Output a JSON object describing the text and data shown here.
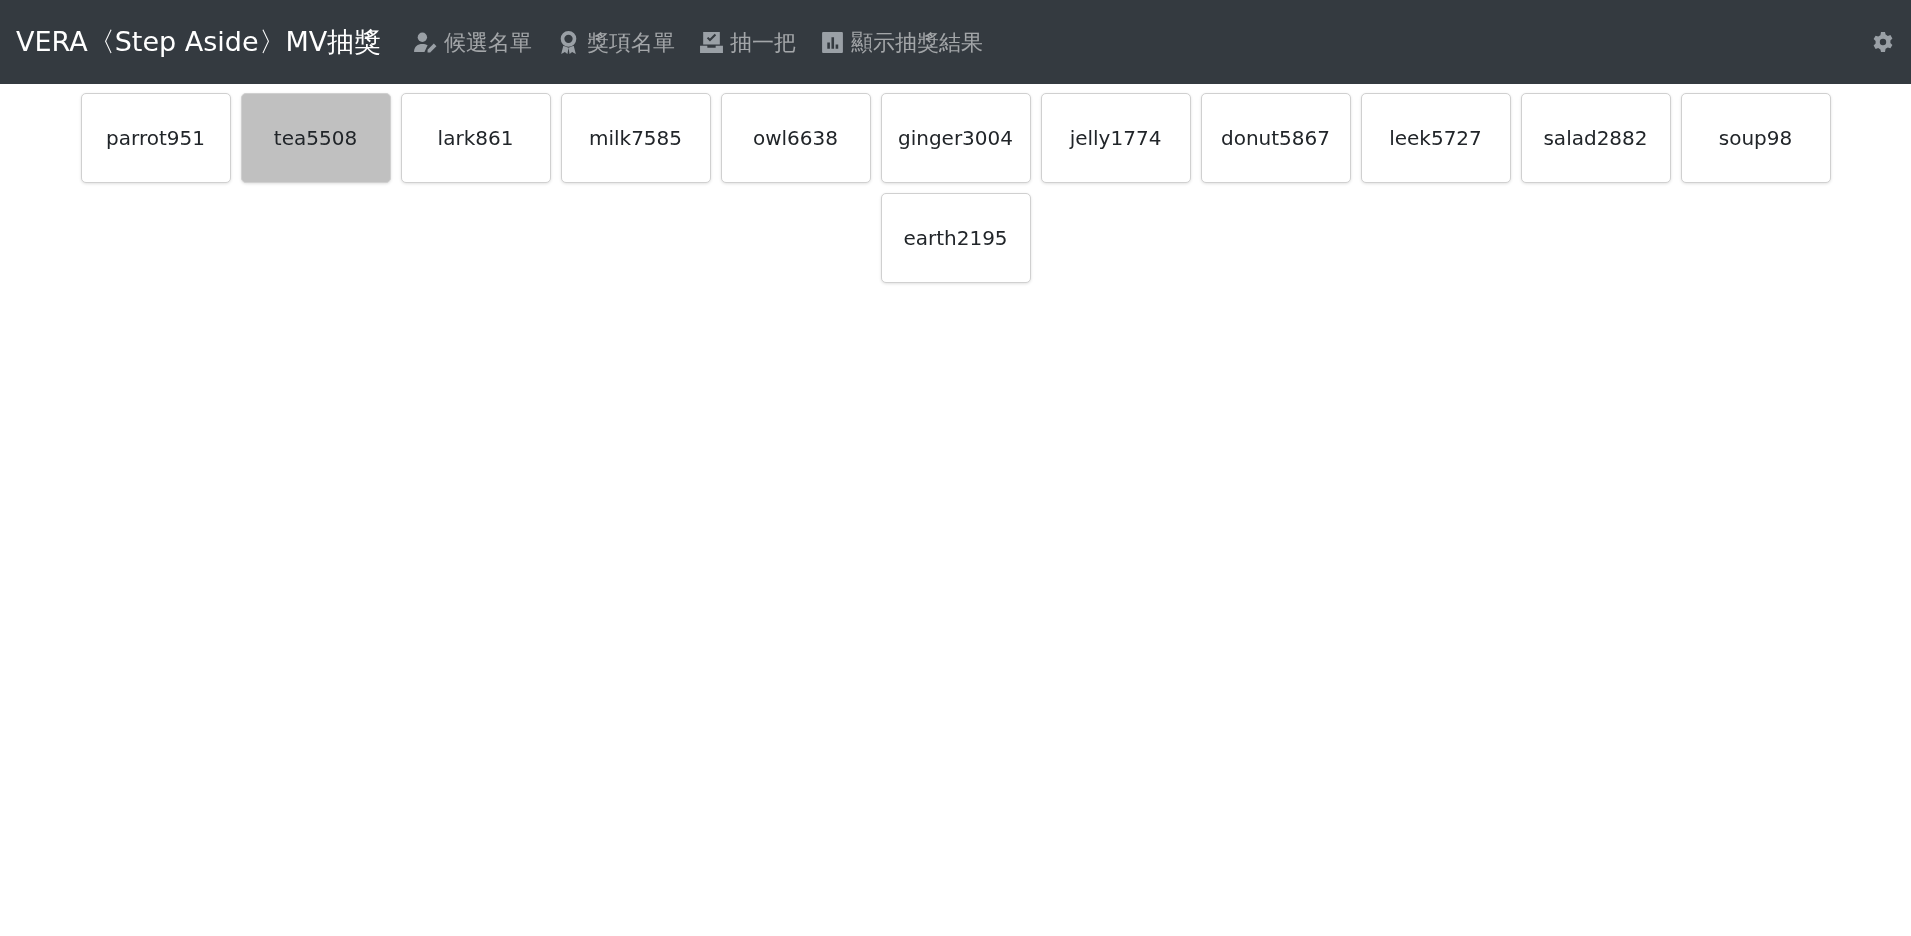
{
  "navbar": {
    "brand": "VERA〈Step Aside〉MV抽獎",
    "links": [
      {
        "label": "候選名單"
      },
      {
        "label": "獎項名單"
      },
      {
        "label": "抽一把"
      },
      {
        "label": "顯示抽獎結果"
      }
    ]
  },
  "candidates": [
    {
      "name": "parrot951",
      "selected": false
    },
    {
      "name": "tea5508",
      "selected": true
    },
    {
      "name": "lark861",
      "selected": false
    },
    {
      "name": "milk7585",
      "selected": false
    },
    {
      "name": "owl6638",
      "selected": false
    },
    {
      "name": "ginger3004",
      "selected": false
    },
    {
      "name": "jelly1774",
      "selected": false
    },
    {
      "name": "donut5867",
      "selected": false
    },
    {
      "name": "leek5727",
      "selected": false
    },
    {
      "name": "salad2882",
      "selected": false
    },
    {
      "name": "soup98",
      "selected": false
    },
    {
      "name": "earth2195",
      "selected": false
    }
  ]
}
